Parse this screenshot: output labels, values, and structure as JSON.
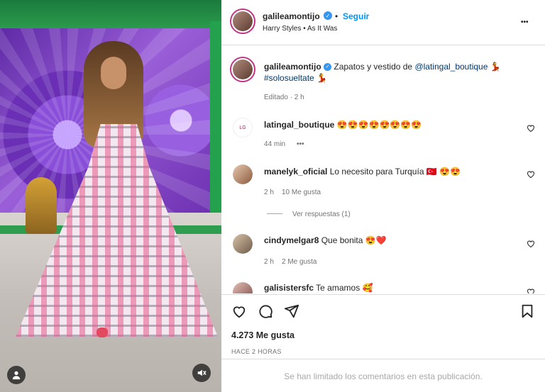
{
  "header": {
    "username": "galileamontijo",
    "dot": "•",
    "follow_label": "Seguir",
    "song": "Harry Styles • As It Was",
    "more_label": "•••"
  },
  "caption": {
    "username": "galileamontijo",
    "text": "Zapatos y vestido de",
    "mention": "@latingal_boutique",
    "hashtag": "#solosueltate",
    "meta": "Editado · 2 h"
  },
  "comments": [
    {
      "username": "latingal_boutique",
      "text": "😍😍😍😍😍😍😍😍",
      "time": "44 min",
      "extra": "•••"
    },
    {
      "username": "manelyk_oficial",
      "text": "Lo necesito para Turquía 🇹🇷 😍😍",
      "time": "2 h",
      "likes": "10 Me gusta",
      "replies": "Ver respuestas (1)"
    },
    {
      "username": "cindymelgar8",
      "text": "Que bonita 😍❤️",
      "time": "2 h",
      "likes": "2 Me gusta"
    },
    {
      "username": "galisistersfc",
      "text": "Te amamos 🥰"
    }
  ],
  "actions": {
    "likes": "4.273 Me gusta",
    "date": "HACE 2 HORAS",
    "limited": "Se han limitado los comentarios en esta publicación."
  },
  "colors": {
    "accent": "#0095f6",
    "verified": "#3797f0",
    "text": "#262626",
    "muted": "#737373"
  }
}
